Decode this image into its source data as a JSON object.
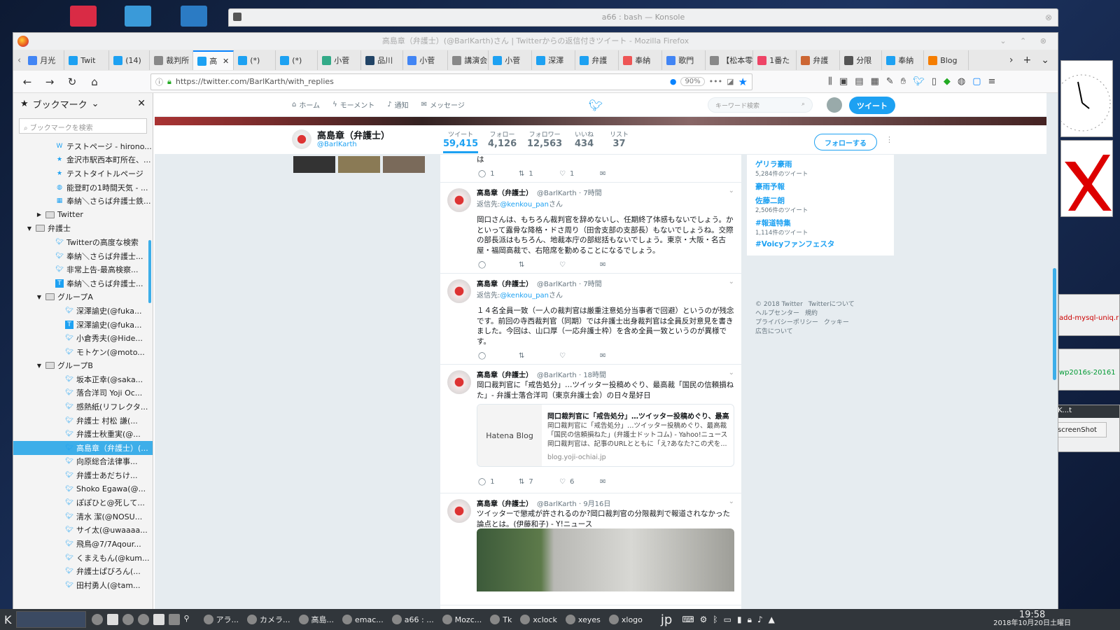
{
  "konsole": {
    "title": "a66 : bash — Konsole"
  },
  "firefox": {
    "title": "高島章（弁護士）(@BarlKarth)さん | Twitterからの返信付きツイート - Mozilla Firefox",
    "tabs": [
      {
        "label": "月光",
        "icon": "google-icon",
        "color": "#4285f4"
      },
      {
        "label": "Twit",
        "icon": "twitter-icon",
        "color": "#1da1f2"
      },
      {
        "label": "(14)",
        "icon": "twitter-icon",
        "color": "#1da1f2"
      },
      {
        "label": "裁判所",
        "icon": "page-icon",
        "color": "#888"
      },
      {
        "label": "高",
        "icon": "twitter-icon",
        "color": "#1da1f2",
        "active": true
      },
      {
        "label": "(*)",
        "icon": "twitter-icon",
        "color": "#1da1f2"
      },
      {
        "label": "(*)",
        "icon": "twitter-icon",
        "color": "#1da1f2"
      },
      {
        "label": "小菅",
        "icon": "page-icon",
        "color": "#3a8"
      },
      {
        "label": "品川",
        "icon": "j-icon",
        "color": "#246"
      },
      {
        "label": "小菅",
        "icon": "google-icon",
        "color": "#4285f4"
      },
      {
        "label": "講演会",
        "icon": "page-icon",
        "color": "#888"
      },
      {
        "label": "小菅",
        "icon": "twitter-icon",
        "color": "#1da1f2"
      },
      {
        "label": "深澤",
        "icon": "twitter-icon",
        "color": "#1da1f2"
      },
      {
        "label": "弁護",
        "icon": "twitter-icon",
        "color": "#1da1f2"
      },
      {
        "label": "奉納",
        "icon": "page-icon",
        "color": "#e55"
      },
      {
        "label": "歌門",
        "icon": "google-icon",
        "color": "#4285f4"
      },
      {
        "label": "【松本零",
        "icon": "page-icon",
        "color": "#888"
      },
      {
        "label": "1番た",
        "icon": "page-icon",
        "color": "#e46"
      },
      {
        "label": "弁護",
        "icon": "page-icon",
        "color": "#c63"
      },
      {
        "label": "分限",
        "icon": "page-icon",
        "color": "#555"
      },
      {
        "label": "奉納",
        "icon": "page-icon",
        "color": "#1da1f2"
      },
      {
        "label": "Blog",
        "icon": "blogger-icon",
        "color": "#f57d00"
      }
    ],
    "url": "https://twitter.com/BarlKarth/with_replies",
    "zoom": "90%"
  },
  "bookmarks": {
    "title": "ブックマーク",
    "search_placeholder": "ブックマークを検索",
    "items": [
      {
        "label": "テストページ - hirono...",
        "icon": "W",
        "depth": 3
      },
      {
        "label": "金沢市駅西本町所在、...",
        "icon": "★",
        "depth": 3
      },
      {
        "label": "テストタイトルページ",
        "icon": "★",
        "depth": 3
      },
      {
        "label": "能登町の1時間天気 - ...",
        "icon": "◍",
        "depth": 3
      },
      {
        "label": "奉納＼さらば弁護士鉄...",
        "icon": "▦",
        "depth": 3
      },
      {
        "label": "Twitter",
        "icon": "folder",
        "depth": 2,
        "arrow": "▶"
      },
      {
        "label": "弁護士",
        "icon": "folder",
        "depth": 1,
        "arrow": "▼"
      },
      {
        "label": "Twitterの高度な検索",
        "icon": "tw",
        "depth": 3
      },
      {
        "label": "奉納＼さらば弁護士...",
        "icon": "tw",
        "depth": 3
      },
      {
        "label": "非常上告-最高検察...",
        "icon": "tw",
        "depth": 3
      },
      {
        "label": "奉納＼さらば弁護士...",
        "icon": "t",
        "depth": 3
      },
      {
        "label": "グループA",
        "icon": "folder",
        "depth": 2,
        "arrow": "▼"
      },
      {
        "label": "深澤諭史(@fuka...",
        "icon": "tw",
        "depth": 4
      },
      {
        "label": "深澤諭史(@fuka...",
        "icon": "t",
        "depth": 4
      },
      {
        "label": "小倉秀夫(@Hide...",
        "icon": "tw",
        "depth": 4
      },
      {
        "label": "モトケン(@moto...",
        "icon": "tw",
        "depth": 4
      },
      {
        "label": "グループB",
        "icon": "folder",
        "depth": 2,
        "arrow": "▼"
      },
      {
        "label": "坂本正幸(@saka...",
        "icon": "tw",
        "depth": 4
      },
      {
        "label": "落合洋司 Yoji Oc...",
        "icon": "tw",
        "depth": 4
      },
      {
        "label": "感熱紙(リフレクタ...",
        "icon": "tw",
        "depth": 4
      },
      {
        "label": "弁護士 村松 謙(...",
        "icon": "tw",
        "depth": 4
      },
      {
        "label": "弁護士秋重実(@...",
        "icon": "tw",
        "depth": 4
      },
      {
        "label": "高島章（弁護士）(...",
        "icon": "tw",
        "depth": 4,
        "selected": true
      },
      {
        "label": "向原総合法律事...",
        "icon": "tw",
        "depth": 4
      },
      {
        "label": "弁護士あだちけ...",
        "icon": "tw",
        "depth": 4
      },
      {
        "label": "Shoko Egawa(@...",
        "icon": "tw",
        "depth": 4
      },
      {
        "label": "ぽぽひと@死して...",
        "icon": "tw",
        "depth": 4
      },
      {
        "label": "清水 潔(@NOSU...",
        "icon": "tw",
        "depth": 4
      },
      {
        "label": "サイ太(@uwaaaa...",
        "icon": "tw",
        "depth": 4
      },
      {
        "label": "飛鳥@7/7Aqour...",
        "icon": "tw",
        "depth": 4
      },
      {
        "label": "くまえもん(@kum...",
        "icon": "tw",
        "depth": 4
      },
      {
        "label": "弁護士ぱびろん(...",
        "icon": "tw",
        "depth": 4
      },
      {
        "label": "田村勇人(@tam...",
        "icon": "tw",
        "depth": 4
      }
    ]
  },
  "twitter": {
    "nav": {
      "home": "ホーム",
      "moments": "モーメント",
      "notifications": "通知",
      "messages": "メッセージ",
      "search_placeholder": "キーワード検索",
      "tweet_button": "ツイート"
    },
    "profile": {
      "name": "高島章（弁護士）",
      "handle": "@BarlKarth",
      "stats": [
        {
          "label": "ツイート",
          "value": "59,415",
          "active": true
        },
        {
          "label": "フォロー",
          "value": "4,126"
        },
        {
          "label": "フォロワー",
          "value": "12,563"
        },
        {
          "label": "いいね",
          "value": "434"
        },
        {
          "label": "リスト",
          "value": "37"
        }
      ],
      "follow_button": "フォローする"
    },
    "partial_tweet": {
      "text": "は",
      "replies": "1",
      "retweets": "1",
      "likes": "1"
    },
    "tweets": [
      {
        "name": "高島章（弁護士）",
        "handle": "@BarlKarth",
        "time": "7時間",
        "reply_prefix": "返信先:",
        "reply_to": "@kenkou_pan",
        "reply_suffix": "さん",
        "text": "岡口さんは、もちろん裁判官を辞めないし、任期終了体感もないでしょう。かといって露骨な降格・ドさ周り（田舎支部の支部長）もないでしょうね。交際の部長派はもちろん、地裁本庁の部総括もないでしょう。東京・大阪・名古屋・福岡高裁で、右陪席を勤めることになるでしょう。",
        "replies": "",
        "retweets": "",
        "likes": ""
      },
      {
        "name": "高島章（弁護士）",
        "handle": "@BarlKarth",
        "time": "7時間",
        "reply_prefix": "返信先:",
        "reply_to": "@kenkou_pan",
        "reply_suffix": "さん",
        "text": "１４名全員一致（一人の裁判官は厳重注意処分当事者で回避）というのが残念です。前回の寺西裁判官（同期）では弁護士出身裁判官は全員反対意見を書きました。今回は、山口厚（一応弁護士枠）を含め全員一致というのが異様です。",
        "replies": "",
        "retweets": "",
        "likes": ""
      },
      {
        "name": "高島章（弁護士）",
        "handle": "@BarlKarth",
        "time": "18時間",
        "text": "岡口裁判官に「戒告処分」…ツイッター投稿めぐり、最高裁「国民の信頼損ねた」- 弁護士落合洋司（東京弁護士会）の日々是好日",
        "card": {
          "logo": "Hatena Blog",
          "title": "岡口裁判官に「戒告処分」…ツイッター投稿めぐり、最高...",
          "desc": "岡口裁判官に「戒告処分」…ツイッター投稿めぐり、最高裁「国民の信頼損ねた」(弁護士ドットコム) - Yahoo!ニュース 岡口裁判官は、記事のURLとともに「え?あなた?この犬を...",
          "url": "blog.yoji-ochiai.jp"
        },
        "replies": "1",
        "retweets": "7",
        "likes": "6"
      },
      {
        "name": "高島章（弁護士）",
        "handle": "@BarlKarth",
        "time": "9月16日",
        "text": "ツイッターで懲戒が許されるのか?岡口裁判官の分限裁判で報道されなかった論点とは。(伊藤和子) - Y!ニュース"
      }
    ],
    "trends": [
      {
        "name": "ゲリラ豪雨",
        "count": "5,284件のツイート"
      },
      {
        "name": "豪雨予報",
        "count": ""
      },
      {
        "name": "佐藤二朗",
        "count": "2,506件のツイート"
      },
      {
        "name": "#報道特集",
        "count": "1,114件のツイート"
      },
      {
        "name": "#Voicyファンフェスタ",
        "count": ""
      }
    ],
    "footer": [
      "© 2018 Twitter",
      "Twitterについて",
      "ヘルプセンター",
      "規約",
      "プライバシーポリシー",
      "クッキー",
      "広告について"
    ]
  },
  "right_windows": {
    "k_title": "K...t",
    "screenshot_label": "screenShot",
    "mysql": "add-mysql-uniq.rl",
    "wp": "wp2016s-20161"
  },
  "taskbar": {
    "items": [
      "アラ...",
      "カメラ...",
      "高島...",
      "emac...",
      "a66 : ...",
      "Mozc...",
      "Tk",
      "xclock",
      "xeyes",
      "xlogo"
    ],
    "ime": "jp",
    "time": "19:58",
    "date": "2018年10月20日土曜日"
  }
}
